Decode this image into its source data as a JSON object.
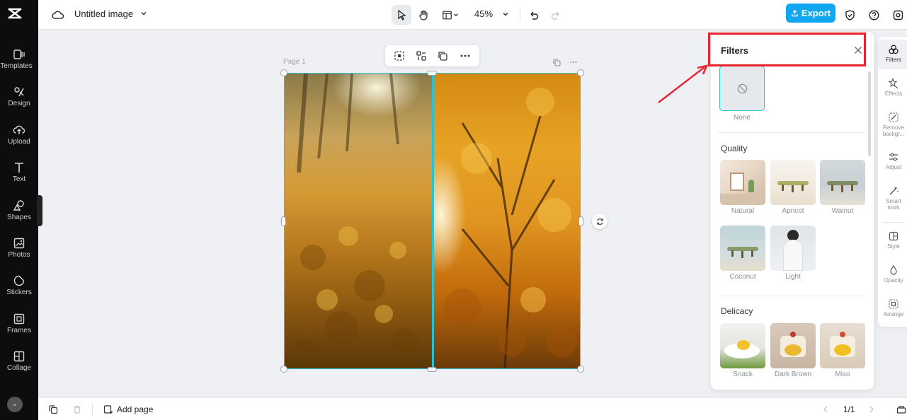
{
  "app": {
    "doc_title": "Untitled image",
    "zoom": "45%",
    "export_label": "Export"
  },
  "sidebar": {
    "items": [
      {
        "label": "Templates",
        "icon": "templates-icon"
      },
      {
        "label": "Design",
        "icon": "design-icon"
      },
      {
        "label": "Upload",
        "icon": "upload-icon"
      },
      {
        "label": "Text",
        "icon": "text-icon"
      },
      {
        "label": "Shapes",
        "icon": "shapes-icon"
      },
      {
        "label": "Photos",
        "icon": "photos-icon"
      },
      {
        "label": "Stickers",
        "icon": "stickers-icon"
      },
      {
        "label": "Frames",
        "icon": "frames-icon"
      },
      {
        "label": "Collage",
        "icon": "collage-icon"
      }
    ]
  },
  "canvas": {
    "page_label": "Page 1"
  },
  "filters": {
    "title": "Filters",
    "none_label": "None",
    "sections": [
      {
        "title": "Quality",
        "items": [
          "Natural",
          "Apricot",
          "Walnut",
          "Coconut",
          "Light"
        ]
      },
      {
        "title": "Delicacy",
        "items": [
          "Snack",
          "Dark Brown",
          "Miso"
        ]
      }
    ]
  },
  "rightrail": {
    "items": [
      {
        "label": "Filters",
        "icon": "filters-icon",
        "active": true
      },
      {
        "label": "Effects",
        "icon": "effects-icon"
      },
      {
        "label": "Remove backgr...",
        "icon": "remove-background-icon"
      },
      {
        "label": "Adjust",
        "icon": "adjust-icon"
      },
      {
        "label": "Smart tools",
        "icon": "smart-tools-icon"
      },
      {
        "label": "Style",
        "icon": "style-icon"
      },
      {
        "label": "Opacity",
        "icon": "opacity-icon"
      },
      {
        "label": "Arrange",
        "icon": "arrange-icon"
      }
    ]
  },
  "bottombar": {
    "add_page": "Add page",
    "page_count": "1/1"
  },
  "colors": {
    "accent": "#11a6f2",
    "selection": "#27c2d8",
    "highlight": "#e8232d"
  }
}
